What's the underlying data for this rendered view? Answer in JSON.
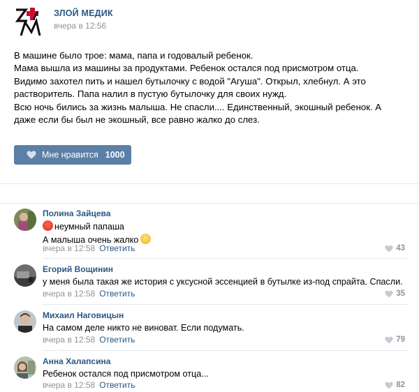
{
  "post": {
    "group_name": "ЗЛОЙ МЕДИК",
    "time": "вчера в 12:56",
    "text_lines": [
      "В машине было трое: мама, папа и годовалый ребенок.",
      "Мама вышла из машины за продуктами. Ребенок остался под присмотром отца.",
      "Видимо захотел пить и нашел бутылочку с водой \"Агуша\". Открыл, хлебнул. А это",
      "растворитель. Папа налил в пустую бутылочку для своих нужд.",
      "Всю ночь бились за жизнь малыша. Не спасли.... Единственный, экошный ребенок. А",
      "даже если бы был не экошный, все равно жалко до слез."
    ],
    "like_label": "Мне нравится",
    "like_count": "1000"
  },
  "comments": [
    {
      "author": "Полина Зайцева",
      "lines": [
        "неумный папаша",
        "А малыша очень жалко"
      ],
      "time": "вчера в 12:58",
      "reply": "Ответить",
      "likes": "43"
    },
    {
      "author": "Егорий Вощинин",
      "lines": [
        "у меня была такая же история с уксусной эссенцией в бутылке из-под спрайта. Спасли."
      ],
      "time": "вчера в 12:58",
      "reply": "Ответить",
      "likes": "35"
    },
    {
      "author": "Михаил Наговицын",
      "lines": [
        "На самом деле никто не виноват. Если подумать."
      ],
      "time": "вчера в 12:58",
      "reply": "Ответить",
      "likes": "79"
    },
    {
      "author": "Анна Халапсина",
      "lines": [
        "Ребенок остался под присмотром отца..."
      ],
      "time": "вчера в 12:58",
      "reply": "Ответить",
      "likes": "82"
    }
  ],
  "colors": {
    "link": "#2a5885",
    "meta": "#939393",
    "like_button": "#5b7fa6",
    "divider": "#e7e8ec"
  },
  "icons": {
    "group_logo": "zm-logo-icon",
    "like": "heart-icon",
    "emoji_1": "angry-face-icon",
    "emoji_2": "sad-face-icon"
  }
}
